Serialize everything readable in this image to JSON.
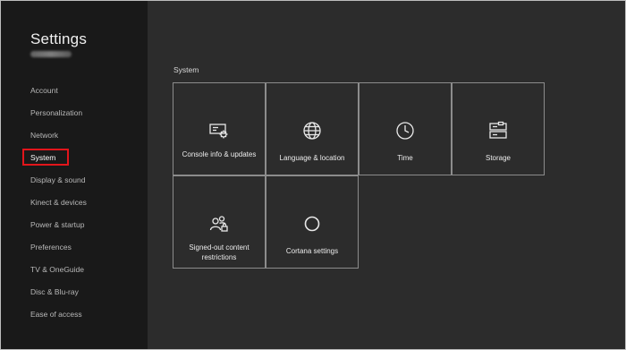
{
  "sidebar": {
    "title": "Settings",
    "items": [
      {
        "label": "Account"
      },
      {
        "label": "Personalization"
      },
      {
        "label": "Network"
      },
      {
        "label": "System"
      },
      {
        "label": "Display & sound"
      },
      {
        "label": "Kinect & devices"
      },
      {
        "label": "Power & startup"
      },
      {
        "label": "Preferences"
      },
      {
        "label": "TV & OneGuide"
      },
      {
        "label": "Disc & Blu-ray"
      },
      {
        "label": "Ease of access"
      }
    ],
    "selected": "System",
    "highlight_color": "#e2151b"
  },
  "main": {
    "section_title": "System",
    "tiles": [
      {
        "label": "Console info & updates",
        "icon": "console-info-icon"
      },
      {
        "label": "Language & location",
        "icon": "globe-icon"
      },
      {
        "label": "Time",
        "icon": "clock-icon"
      },
      {
        "label": "Storage",
        "icon": "storage-icon"
      },
      {
        "label": "Signed-out content restrictions",
        "icon": "restricted-users-icon"
      },
      {
        "label": "Cortana settings",
        "icon": "cortana-icon"
      }
    ]
  },
  "colors": {
    "background": "#2c2c2c",
    "sidebar": "#191919",
    "tile_border": "#8c8c8c",
    "text": "#ececec"
  }
}
